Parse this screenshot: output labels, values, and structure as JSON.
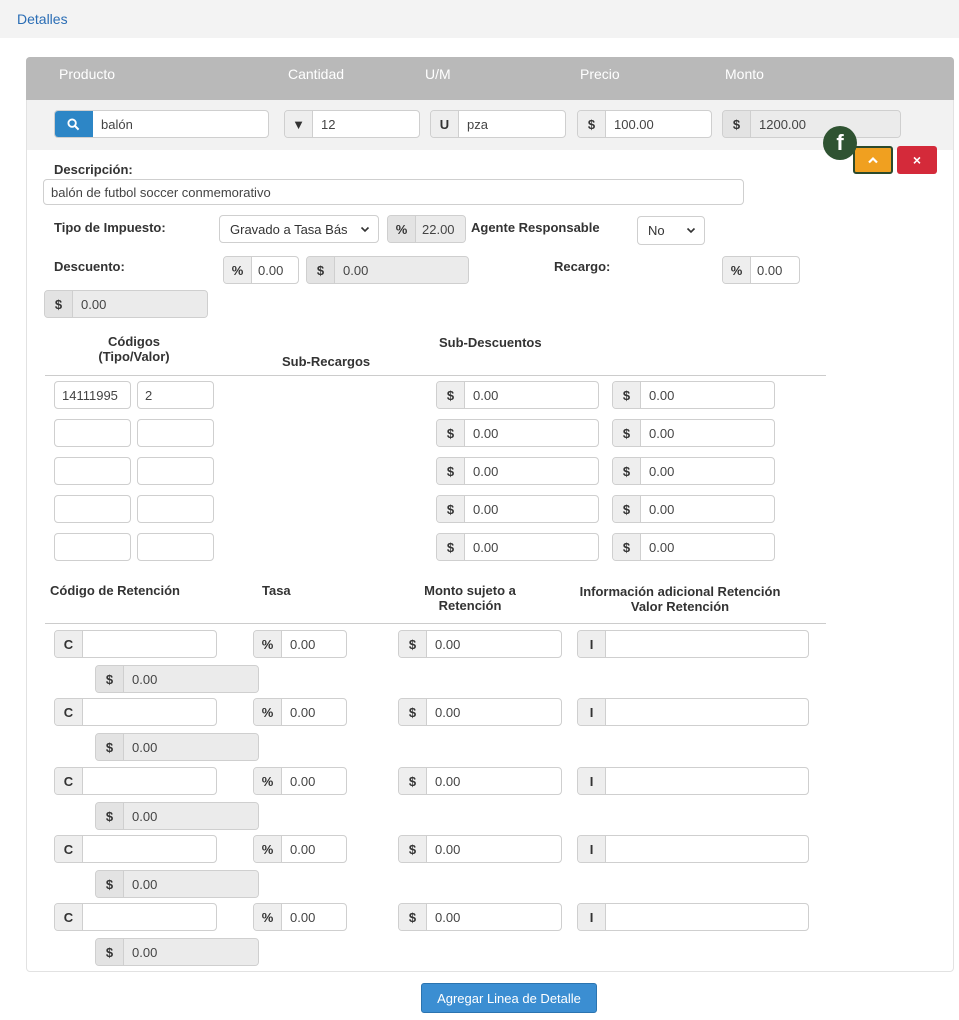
{
  "section_title": "Detalles",
  "columns": {
    "producto": "Producto",
    "cantidad": "Cantidad",
    "um": "U/M",
    "precio": "Precio",
    "monto": "Monto"
  },
  "product_row": {
    "product": "balón",
    "cantidad_prefix": "▼",
    "cantidad": "12",
    "um_prefix": "U",
    "um": "pza",
    "precio_prefix": "$",
    "precio": "100.00",
    "monto_prefix": "$",
    "monto": "1200.00"
  },
  "badge_letter": "f",
  "remove_label": "×",
  "descripcion": {
    "label": "Descripción:",
    "value": "balón de futbol soccer conmemorativo"
  },
  "impuesto": {
    "label": "Tipo de Impuesto:",
    "selected": "Gravado a Tasa Bás",
    "pct_prefix": "%",
    "pct": "22.00"
  },
  "agente": {
    "label": "Agente Responsable",
    "selected": "No"
  },
  "descuento": {
    "label": "Descuento:",
    "pct_prefix": "%",
    "pct": "0.00",
    "amt_prefix": "$",
    "amt": "0.00",
    "total_prefix": "$",
    "total": "0.00"
  },
  "recargo": {
    "label": "Recargo:",
    "pct_prefix": "%",
    "pct": "0.00"
  },
  "codes_header": {
    "codigos_l1": "Códigos",
    "codigos_l2": "(Tipo/Valor)",
    "subrecargos": "Sub-Recargos",
    "subdescuentos": "Sub-Descuentos"
  },
  "codes_rows": [
    {
      "tipo": "14111995",
      "valor": "2",
      "sd1": "0.00",
      "sd2": "0.00"
    },
    {
      "tipo": "",
      "valor": "",
      "sd1": "0.00",
      "sd2": "0.00"
    },
    {
      "tipo": "",
      "valor": "",
      "sd1": "0.00",
      "sd2": "0.00"
    },
    {
      "tipo": "",
      "valor": "",
      "sd1": "0.00",
      "sd2": "0.00"
    },
    {
      "tipo": "",
      "valor": "",
      "sd1": "0.00",
      "sd2": "0.00"
    }
  ],
  "dollar_prefix": "$",
  "ret_header": {
    "codigo": "Código de Retención",
    "tasa": "Tasa",
    "monto_l1": "Monto sujeto a",
    "monto_l2": "Retención",
    "info_l1": "Información adicional Retención",
    "info_l2": "Valor Retención"
  },
  "ret_prefixes": {
    "codigo": "C",
    "tasa": "%",
    "monto": "$",
    "info": "I",
    "valor": "$"
  },
  "ret_rows": [
    {
      "codigo": "",
      "tasa": "0.00",
      "monto": "0.00",
      "info": "",
      "valor": "0.00"
    },
    {
      "codigo": "",
      "tasa": "0.00",
      "monto": "0.00",
      "info": "",
      "valor": "0.00"
    },
    {
      "codigo": "",
      "tasa": "0.00",
      "monto": "0.00",
      "info": "",
      "valor": "0.00"
    },
    {
      "codigo": "",
      "tasa": "0.00",
      "monto": "0.00",
      "info": "",
      "valor": "0.00"
    },
    {
      "codigo": "",
      "tasa": "0.00",
      "monto": "0.00",
      "info": "",
      "valor": "0.00"
    }
  ],
  "add_button": "Agregar Linea de Detalle"
}
